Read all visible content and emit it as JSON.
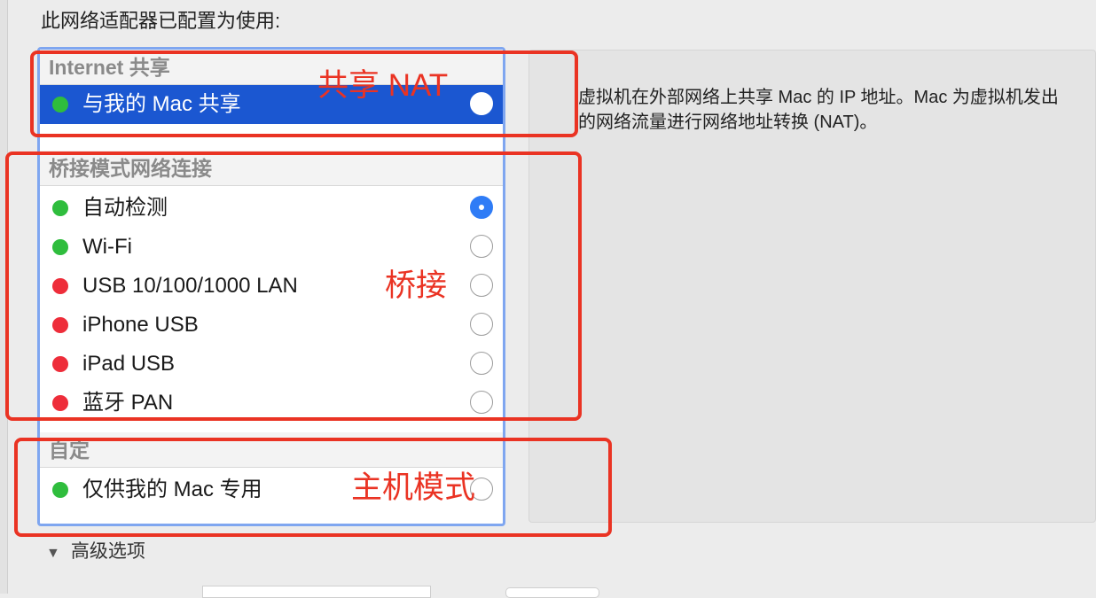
{
  "heading": "此网络适配器已配置为使用:",
  "sections": {
    "internet_sharing": {
      "header": "Internet 共享",
      "items": [
        {
          "label": "与我的 Mac 共享",
          "status": "green",
          "selected": true,
          "checked": false
        }
      ]
    },
    "bridged": {
      "header": "桥接模式网络连接",
      "items": [
        {
          "label": "自动检测",
          "status": "green",
          "checked": true
        },
        {
          "label": "Wi-Fi",
          "status": "green",
          "checked": false
        },
        {
          "label": "USB 10/100/1000 LAN",
          "status": "red",
          "checked": false
        },
        {
          "label": "iPhone USB",
          "status": "red",
          "checked": false
        },
        {
          "label": "iPad USB",
          "status": "red",
          "checked": false
        },
        {
          "label": "蓝牙 PAN",
          "status": "red",
          "checked": false
        }
      ]
    },
    "custom": {
      "header": "自定",
      "items": [
        {
          "label": "仅供我的 Mac 专用",
          "status": "green",
          "checked": false
        }
      ]
    }
  },
  "description": "虚拟机在外部网络上共享 Mac 的 IP 地址。Mac 为虚拟机发出的网络流量进行网络地址转换 (NAT)。",
  "annotations": {
    "nat": "共享 NAT",
    "bridge": "桥接",
    "host_only": "主机模式"
  },
  "advanced_label": "高级选项",
  "colors": {
    "selection": "#1b57d1",
    "status_green": "#2fbd3d",
    "status_red": "#ee2d3a",
    "annotation": "#ea3323",
    "list_focus_ring": "#7fa6f0"
  }
}
